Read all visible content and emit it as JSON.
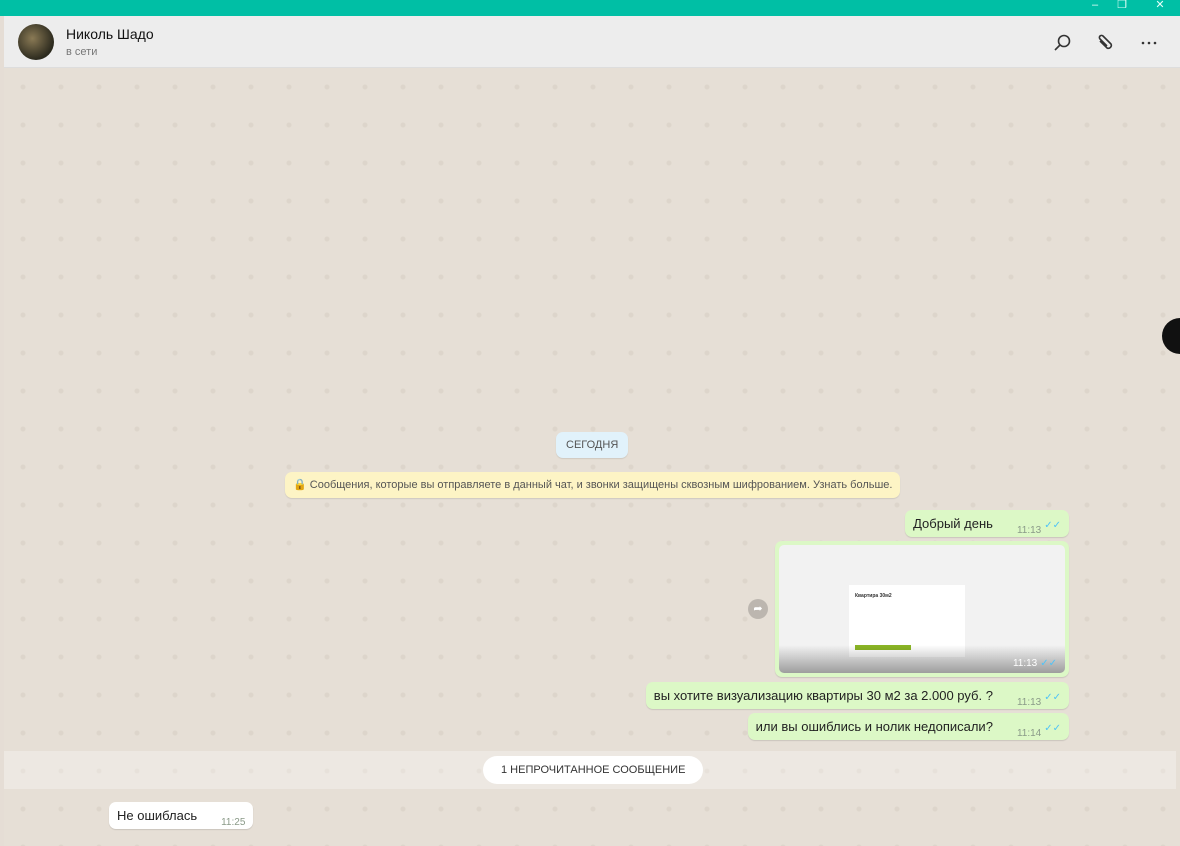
{
  "window": {
    "minimize": "–",
    "restore": "❐",
    "close": "✕"
  },
  "header": {
    "name": "Николь Шадо",
    "status": "в сети"
  },
  "chat": {
    "day_label": "СЕГОДНЯ",
    "encryption_notice": "Сообщения, которые вы отправляете в данный чат, и звонки защищены сквозным шифрованием. Узнать больше.",
    "messages": [
      {
        "text": "Добрый день",
        "time": "11:13",
        "ticks": "✓✓"
      },
      {
        "image_title": "Квартира 30м2",
        "time": "11:13",
        "ticks": "✓✓"
      },
      {
        "text": "вы хотите визуализацию квартиры 30 м2 за 2.000 руб. ?",
        "time": "11:13",
        "ticks": "✓✓"
      },
      {
        "text": "или вы ошиблись и нолик недописали?",
        "time": "11:14",
        "ticks": "✓✓"
      }
    ],
    "unread_label": "1 НЕПРОЧИТАННОЕ СООБЩЕНИЕ",
    "incoming": {
      "text": "Не ошиблась",
      "time": "11:25"
    }
  }
}
